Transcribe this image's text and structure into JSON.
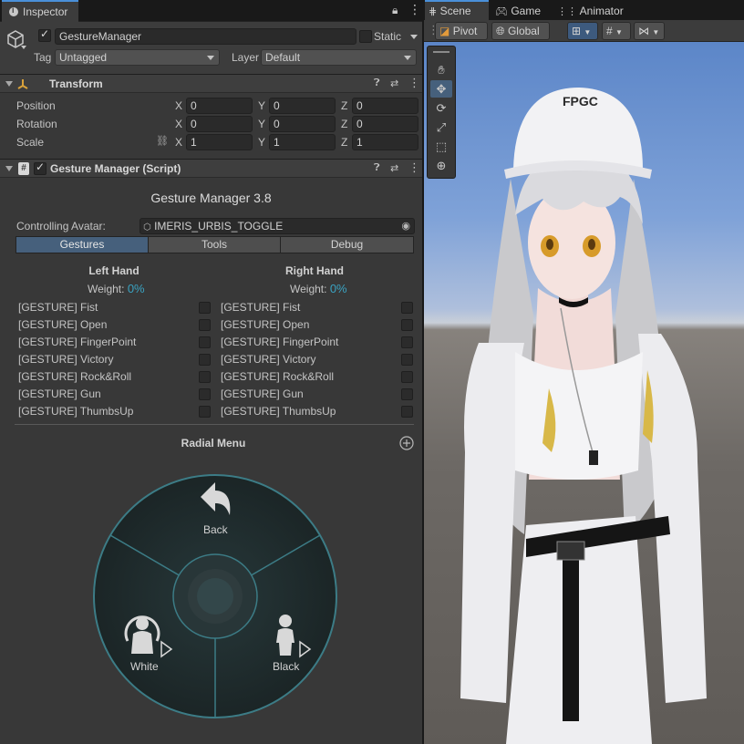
{
  "inspector": {
    "tab_label": "Inspector",
    "object": {
      "name": "GestureManager",
      "static_label": "Static",
      "tag_label": "Tag",
      "tag_value": "Untagged",
      "layer_label": "Layer",
      "layer_value": "Default"
    },
    "transform": {
      "title": "Transform",
      "rows": [
        {
          "label": "Position",
          "x": "0",
          "y": "0",
          "z": "0"
        },
        {
          "label": "Rotation",
          "x": "0",
          "y": "0",
          "z": "0"
        },
        {
          "label": "Scale",
          "x": "1",
          "y": "1",
          "z": "1"
        }
      ],
      "axis_x": "X",
      "axis_y": "Y",
      "axis_z": "Z"
    },
    "script": {
      "title": "Gesture Manager (Script)",
      "heading": "Gesture Manager 3.8",
      "avatar_label": "Controlling Avatar:",
      "avatar_value": "IMERIS_URBIS_TOGGLE",
      "tabs": [
        "Gestures",
        "Tools",
        "Debug"
      ],
      "left_hand": "Left Hand",
      "right_hand": "Right Hand",
      "weight_label": "Weight:",
      "left_weight": "0%",
      "right_weight": "0%",
      "gestures": [
        "[GESTURE] Fist",
        "[GESTURE] Open",
        "[GESTURE] FingerPoint",
        "[GESTURE] Victory",
        "[GESTURE] Rock&Roll",
        "[GESTURE] Gun",
        "[GESTURE] ThumbsUp"
      ],
      "radial_title": "Radial Menu",
      "radial_items": {
        "back": "Back",
        "white": "White",
        "black": "Black"
      }
    }
  },
  "scene": {
    "tabs": [
      "Scene",
      "Game",
      "Animator"
    ],
    "pivot": "Pivot",
    "global": "Global",
    "cap_text": "FPGC"
  },
  "colors": {
    "accent": "#46607c",
    "weight_value": "#3aa3c2",
    "radial_fill": "#1d2a2c",
    "radial_ring": "#3c7c86"
  }
}
